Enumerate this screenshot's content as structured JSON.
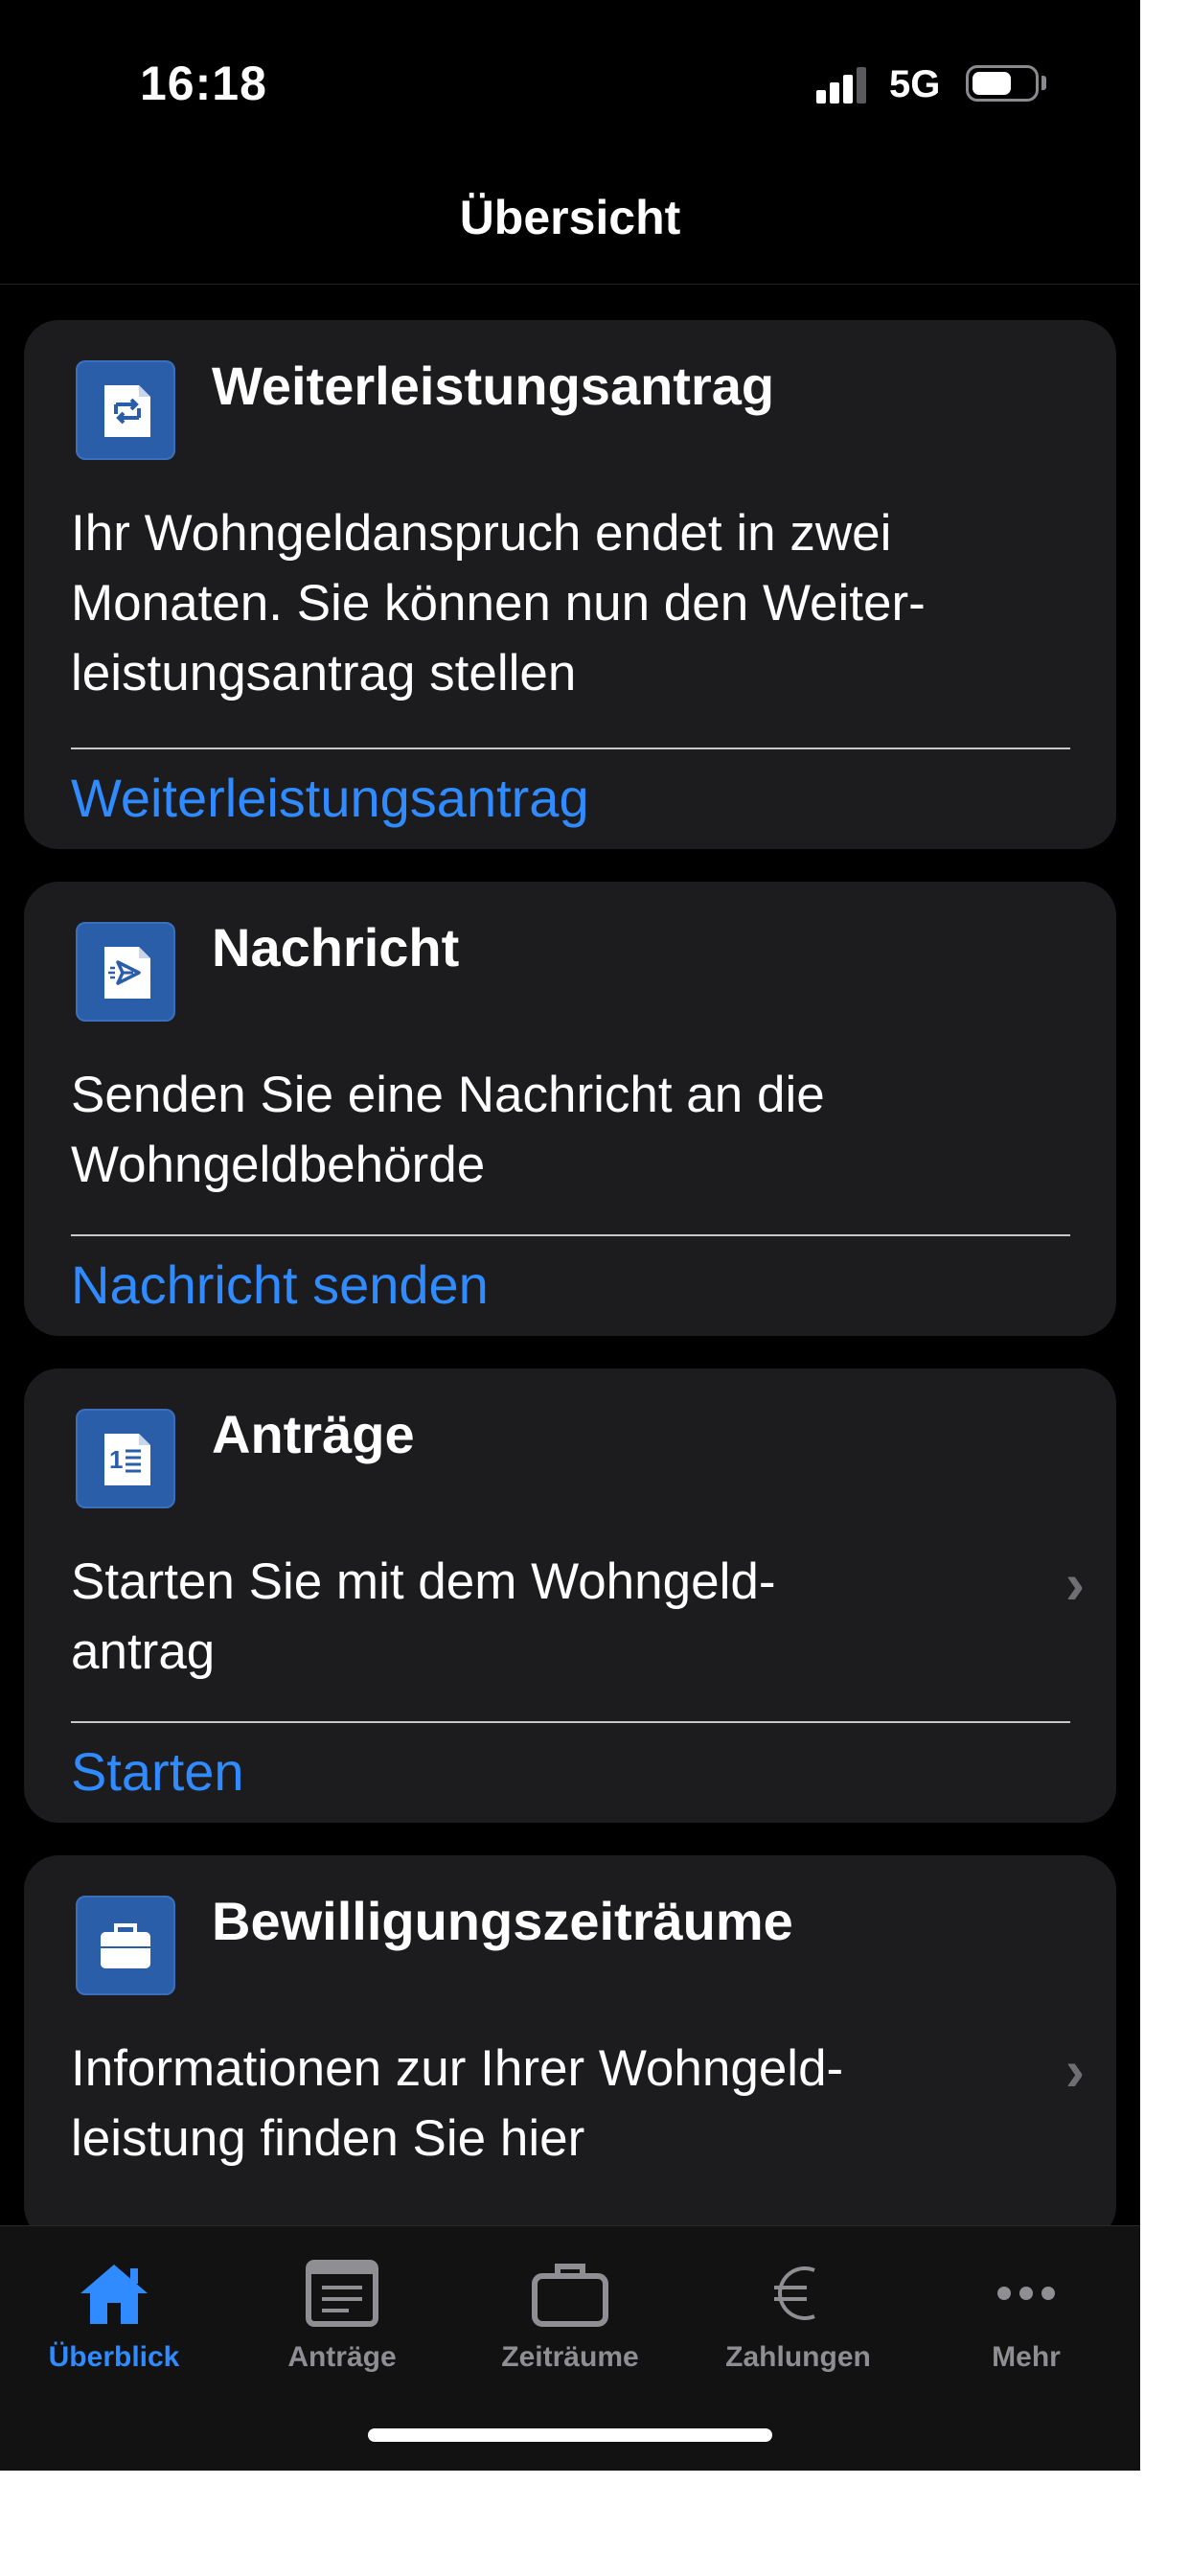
{
  "status_bar": {
    "time": "16:18",
    "network": "5G"
  },
  "nav": {
    "title": "Übersicht"
  },
  "cards": [
    {
      "icon": "document-forward-icon",
      "title": "Weiterleistungsantrag",
      "body_lines": [
        "Ihr Wohngeldanspruch endet in zwei",
        "Monaten. Sie können nun den Weiter-",
        "leistungsantrag stellen"
      ],
      "link": "Weiterleistungsantrag"
    },
    {
      "icon": "document-send-icon",
      "title": "Nachricht",
      "body_lines": [
        "Senden Sie eine Nachricht an die",
        "Wohngeldbehörde"
      ],
      "link": "Nachricht senden"
    },
    {
      "icon": "document-list-icon",
      "title": "Anträge",
      "body_lines": [
        "Starten Sie mit dem Wohngeld-",
        "antrag"
      ],
      "link": "Starten"
    },
    {
      "icon": "briefcase-icon",
      "title": "Bewilligungszeiträume",
      "body_lines": [
        "Informationen zur Ihrer Wohngeld-",
        "leistung finden Sie hier"
      ]
    }
  ],
  "tabs": [
    {
      "label": "Überblick",
      "icon": "home-icon",
      "active": true
    },
    {
      "label": "Anträge",
      "icon": "inbox-icon",
      "active": false
    },
    {
      "label": "Zeiträume",
      "icon": "briefcase-icon",
      "active": false
    },
    {
      "label": "Zahlungen",
      "icon": "euro-icon",
      "active": false
    },
    {
      "label": "Mehr",
      "icon": "more-icon",
      "active": false
    }
  ],
  "colors": {
    "accent": "#2f8bff",
    "card_background": "#1c1c1e",
    "icon_background": "#2a5ea8",
    "inactive_tab": "#8e8e93"
  }
}
